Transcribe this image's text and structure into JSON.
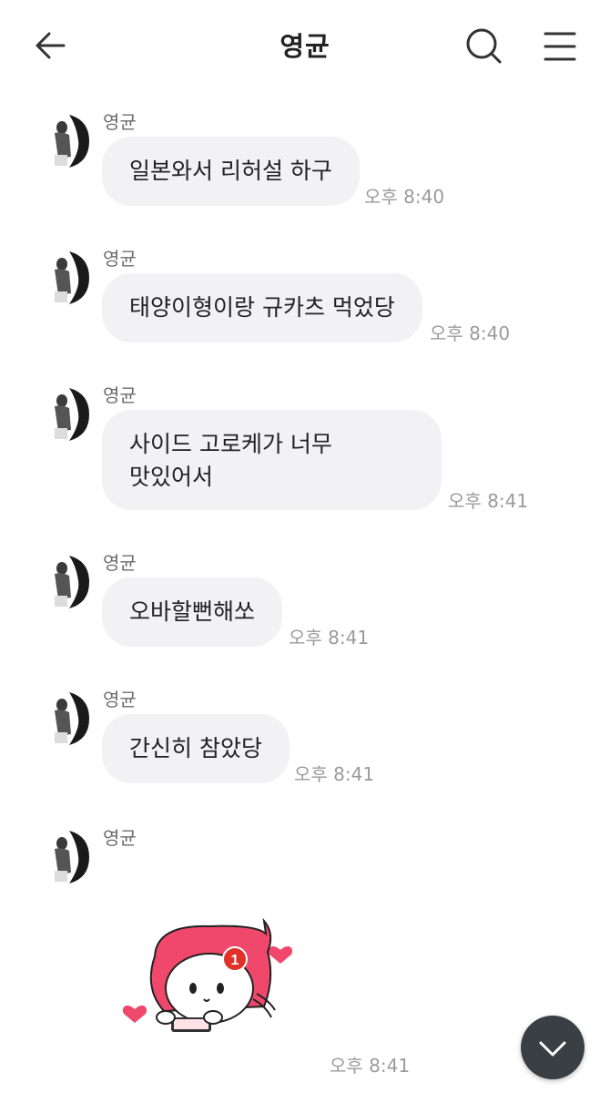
{
  "header": {
    "title": "영균",
    "back_icon": "arrow-left-icon",
    "search_icon": "search-icon",
    "menu_icon": "hamburger-menu-icon"
  },
  "messages": [
    {
      "sender": "영균",
      "text": "일본와서 리허설 하구",
      "time": "오후 8:40"
    },
    {
      "sender": "영균",
      "text": "태양이형이랑 규카츠 먹었당",
      "time": "오후 8:40"
    },
    {
      "sender": "영균",
      "text": "사이드 고로케가 너무\n맛있어서",
      "time": "오후 8:41"
    },
    {
      "sender": "영균",
      "text": "오바할뻔해쏘",
      "time": "오후 8:41"
    },
    {
      "sender": "영균",
      "text": "간신히 참았당",
      "time": "오후 8:41"
    },
    {
      "sender": "영균",
      "sticker": "pink-hooded-character-sticker",
      "sticker_badge": "1",
      "time": "오후 8:41"
    }
  ],
  "scroll_button": {
    "icon": "chevron-down-icon"
  },
  "colors": {
    "bubble": "#f2f2f5",
    "sticker_pink": "#f0486b",
    "scroll_button": "#3a3f44"
  }
}
